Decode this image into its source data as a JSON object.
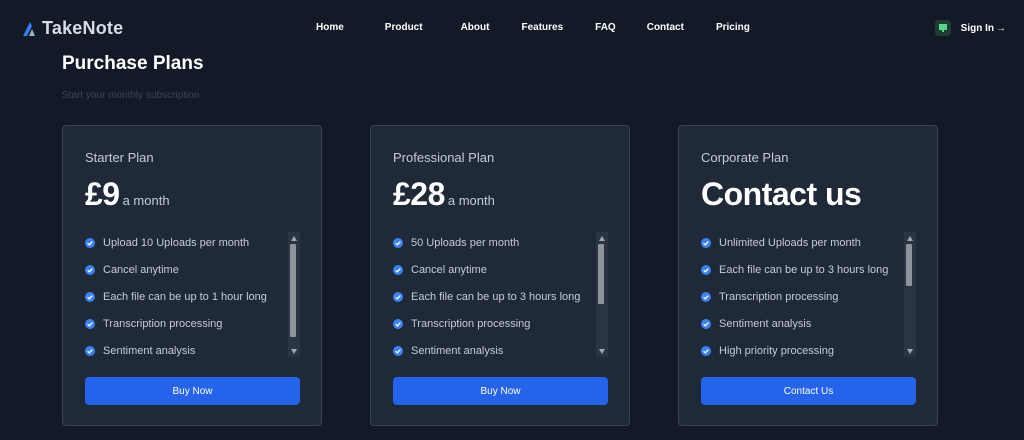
{
  "brand": {
    "name": "TakeNote",
    "accent": "#2f80ed"
  },
  "nav": {
    "links": [
      "Home",
      "Product",
      "About",
      "Features",
      "FAQ",
      "Contact",
      "Pricing"
    ],
    "signin_label": "Sign In",
    "signin_icon": "arrow-right-icon",
    "monitor_icon": "monitor-icon"
  },
  "header": {
    "title": "Purchase Plans",
    "subtitle": "Start your monthly subscription"
  },
  "plans": [
    {
      "name": "Starter Plan",
      "price": "£9",
      "period": "a month",
      "features": [
        "Upload 10 Uploads per month",
        "Cancel anytime",
        "Each file can be up to 1 hour long",
        "Transcription processing",
        "Sentiment analysis"
      ],
      "button": "Buy Now"
    },
    {
      "name": "Professional Plan",
      "price": "£28",
      "period": "a month",
      "features": [
        "50 Uploads per month",
        "Cancel anytime",
        "Each file can be up to 3 hours long",
        "Transcription processing",
        "Sentiment analysis"
      ],
      "button": "Buy Now"
    },
    {
      "name": "Corporate Plan",
      "price": "Contact us",
      "period": "",
      "features": [
        "Unlimited Uploads per month",
        "Each file can be up to 3 hours long",
        "Transcription processing",
        "Sentiment analysis",
        "High priority processing"
      ],
      "button": "Contact Us"
    }
  ],
  "colors": {
    "background": "#121a27",
    "card": "#1f2937",
    "button": "#2563eb",
    "check": "#3b82f6"
  }
}
